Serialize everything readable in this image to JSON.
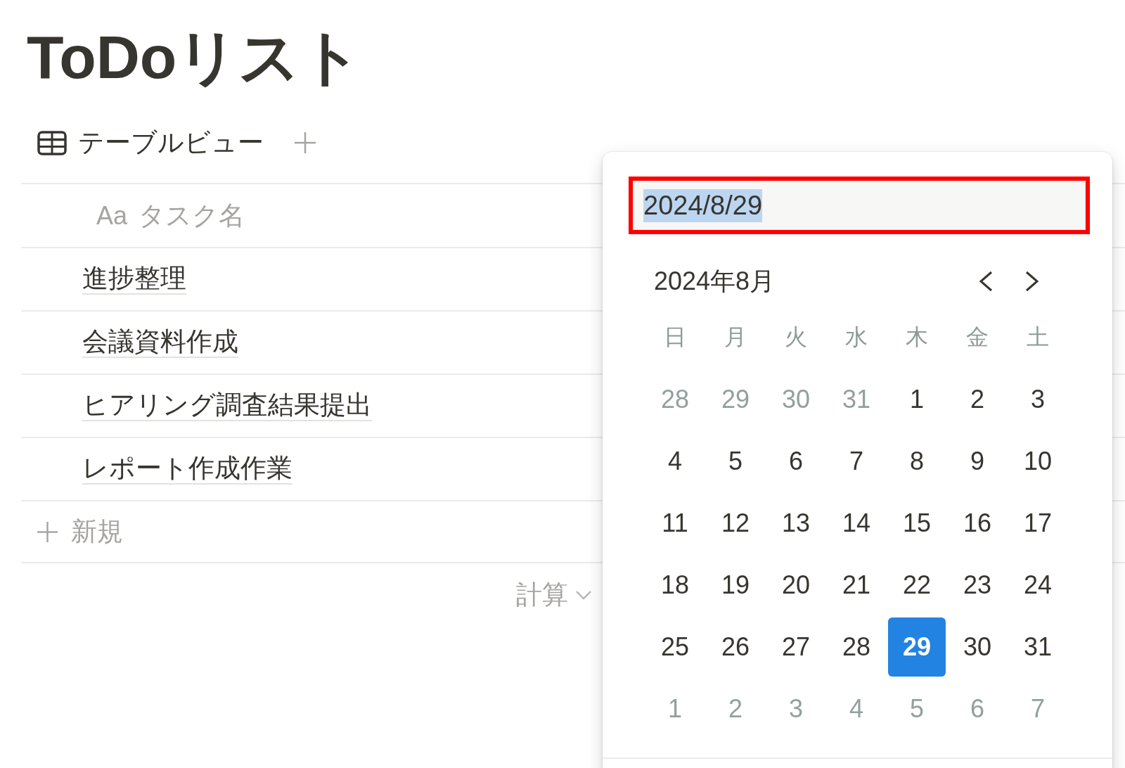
{
  "page": {
    "title": "ToDoリスト"
  },
  "view_tabs": [
    {
      "label": "テーブルビュー"
    }
  ],
  "table": {
    "columns": [
      {
        "type_glyph": "Aa",
        "label": "タスク名"
      }
    ],
    "rows": [
      {
        "name": "進捗整理"
      },
      {
        "name": "会議資料作成"
      },
      {
        "name": "ヒアリング調査結果提出"
      },
      {
        "name": "レポート作成作業"
      }
    ],
    "new_row_label": "新規",
    "calculate_label": "計算"
  },
  "date_picker": {
    "input": {
      "value": "2024/8/29",
      "text_selected": true,
      "annotated": true
    },
    "month_label": "2024年8月",
    "weekdays": [
      "日",
      "月",
      "火",
      "水",
      "木",
      "金",
      "土"
    ],
    "weeks": [
      [
        {
          "day": "28",
          "in_month": false,
          "selected": false
        },
        {
          "day": "29",
          "in_month": false,
          "selected": false
        },
        {
          "day": "30",
          "in_month": false,
          "selected": false
        },
        {
          "day": "31",
          "in_month": false,
          "selected": false
        },
        {
          "day": "1",
          "in_month": true,
          "selected": false
        },
        {
          "day": "2",
          "in_month": true,
          "selected": false
        },
        {
          "day": "3",
          "in_month": true,
          "selected": false
        }
      ],
      [
        {
          "day": "4",
          "in_month": true,
          "selected": false
        },
        {
          "day": "5",
          "in_month": true,
          "selected": false
        },
        {
          "day": "6",
          "in_month": true,
          "selected": false
        },
        {
          "day": "7",
          "in_month": true,
          "selected": false
        },
        {
          "day": "8",
          "in_month": true,
          "selected": false
        },
        {
          "day": "9",
          "in_month": true,
          "selected": false
        },
        {
          "day": "10",
          "in_month": true,
          "selected": false
        }
      ],
      [
        {
          "day": "11",
          "in_month": true,
          "selected": false
        },
        {
          "day": "12",
          "in_month": true,
          "selected": false
        },
        {
          "day": "13",
          "in_month": true,
          "selected": false
        },
        {
          "day": "14",
          "in_month": true,
          "selected": false
        },
        {
          "day": "15",
          "in_month": true,
          "selected": false
        },
        {
          "day": "16",
          "in_month": true,
          "selected": false
        },
        {
          "day": "17",
          "in_month": true,
          "selected": false
        }
      ],
      [
        {
          "day": "18",
          "in_month": true,
          "selected": false
        },
        {
          "day": "19",
          "in_month": true,
          "selected": false
        },
        {
          "day": "20",
          "in_month": true,
          "selected": false
        },
        {
          "day": "21",
          "in_month": true,
          "selected": false
        },
        {
          "day": "22",
          "in_month": true,
          "selected": false
        },
        {
          "day": "23",
          "in_month": true,
          "selected": false
        },
        {
          "day": "24",
          "in_month": true,
          "selected": false
        }
      ],
      [
        {
          "day": "25",
          "in_month": true,
          "selected": false
        },
        {
          "day": "26",
          "in_month": true,
          "selected": false
        },
        {
          "day": "27",
          "in_month": true,
          "selected": false
        },
        {
          "day": "28",
          "in_month": true,
          "selected": false
        },
        {
          "day": "29",
          "in_month": true,
          "selected": true
        },
        {
          "day": "30",
          "in_month": true,
          "selected": false
        },
        {
          "day": "31",
          "in_month": true,
          "selected": false
        }
      ],
      [
        {
          "day": "1",
          "in_month": false,
          "selected": false
        },
        {
          "day": "2",
          "in_month": false,
          "selected": false
        },
        {
          "day": "3",
          "in_month": false,
          "selected": false
        },
        {
          "day": "4",
          "in_month": false,
          "selected": false
        },
        {
          "day": "5",
          "in_month": false,
          "selected": false
        },
        {
          "day": "6",
          "in_month": false,
          "selected": false
        },
        {
          "day": "7",
          "in_month": false,
          "selected": false
        }
      ]
    ]
  }
}
